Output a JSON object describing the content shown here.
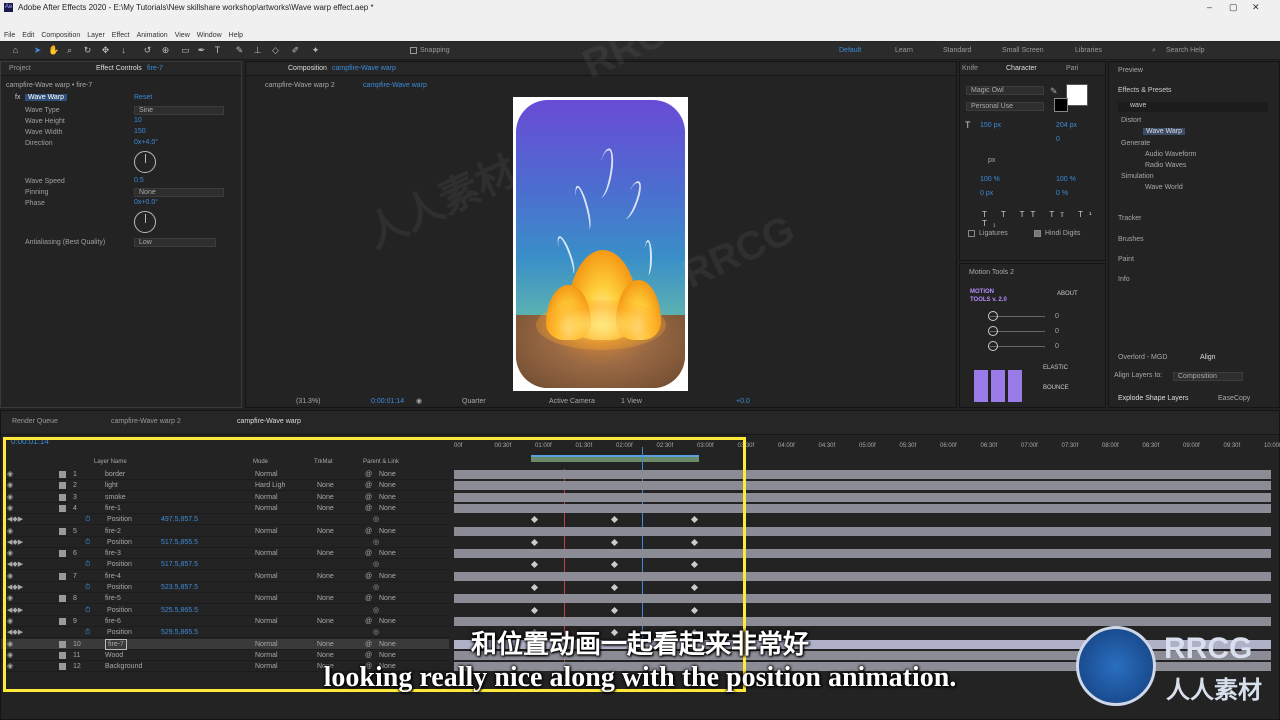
{
  "titlebar": {
    "title": "Adobe After Effects 2020 - E:\\My Tutorials\\New skillshare workshop\\artworks\\Wave warp effect.aep *"
  },
  "menu": [
    "File",
    "Edit",
    "Composition",
    "Layer",
    "Effect",
    "Animation",
    "View",
    "Window",
    "Help"
  ],
  "toolbar": {
    "snapping": "Snapping",
    "workspaces": [
      "Default",
      "Learn",
      "Standard",
      "Small Screen",
      "Libraries"
    ],
    "search_placeholder": "Search Help"
  },
  "project": {
    "tab_project": "Project",
    "tab_effect": "Effect Controls",
    "tab_effect_layer": "fire-7",
    "path": "campfire-Wave warp • fire-7"
  },
  "effect": {
    "name": "Wave Warp",
    "reset": "Reset",
    "rows": [
      {
        "label": "Wave Type",
        "value": "Sine"
      },
      {
        "label": "Wave Height",
        "value": "10"
      },
      {
        "label": "Wave Width",
        "value": "150"
      },
      {
        "label": "Direction",
        "value": "0x+4.0°"
      },
      {
        "label": "Wave Speed",
        "value": "0.5"
      },
      {
        "label": "Pinning",
        "value": "None"
      },
      {
        "label": "Phase",
        "value": "0x+0.0°"
      },
      {
        "label": "Antialiasing (Best Quality)",
        "value": "Low"
      }
    ]
  },
  "composition": {
    "tab": "Composition",
    "tab_comp": "campfire-Wave warp",
    "crumbs": [
      "campfire-Wave warp 2",
      "campfire-Wave warp"
    ],
    "zoom": "(31.3%)",
    "time": "0:00:01:14",
    "resolution": "Quarter",
    "camera": "Active Camera",
    "view": "1 View",
    "exposure": "+0.0"
  },
  "character": {
    "tabs": [
      "Knife",
      "Character",
      "Pari"
    ],
    "font": "Magic Owl",
    "style": "Personal Use",
    "size": "150 px",
    "leading": "204 px",
    "tracking": "0",
    "units": "px",
    "vscale": "100 %",
    "hscale": "100 %",
    "baseline": "0 px",
    "tsume": "0 %",
    "ligatures": "Ligatures",
    "hindi": "Hindi Digits"
  },
  "motion_tools": {
    "title": "Motion Tools 2",
    "logo": "MOTION TOOLS v. 2.0",
    "about": "ABOUT",
    "values": [
      "0",
      "0",
      "0"
    ],
    "elastic": "ELASTIC",
    "bounce": "BOUNCE"
  },
  "overlord": {
    "tabs": [
      "Overlord - MGD",
      "Align"
    ],
    "align_to_label": "Align Layers to:",
    "align_to": "Composition",
    "explode": "Explode Shape Layers",
    "ease": "EaseCopy"
  },
  "right": {
    "preview": "Preview",
    "effects_presets": "Effects & Presets",
    "search": "wave",
    "tree": [
      {
        "label": "Distort",
        "items": [
          "Wave Warp"
        ]
      },
      {
        "label": "Generate",
        "items": [
          "Audio Waveform",
          "Radio Waves"
        ]
      },
      {
        "label": "Simulation",
        "items": [
          "Wave World"
        ]
      }
    ],
    "panels": [
      "Tracker",
      "Brushes",
      "Paint",
      "Info"
    ]
  },
  "timeline": {
    "tabs": [
      "Render Queue",
      "campfire-Wave warp 2",
      "campfire-Wave warp"
    ],
    "time_code": "0:00:01:14",
    "columns": {
      "name": "Layer Name",
      "mode": "Mode",
      "trkmat": "TrkMat",
      "parent": "Parent & Link"
    },
    "ruler": [
      "00f",
      "00:30f",
      "01:00f",
      "01:30f",
      "02:00f",
      "02:30f",
      "03:00f",
      "03:30f",
      "04:00f",
      "04:30f",
      "05:00f",
      "05:30f",
      "06:00f",
      "06:30f",
      "07:00f",
      "07:30f",
      "08:00f",
      "08:30f",
      "09:00f",
      "09:30f",
      "10:00f"
    ],
    "layers": [
      {
        "num": "1",
        "name": "border",
        "mode": "Normal",
        "trk": "",
        "parent": "None"
      },
      {
        "num": "2",
        "name": "light",
        "mode": "Hard Ligh",
        "trk": "None",
        "parent": "None"
      },
      {
        "num": "3",
        "name": "smoke",
        "mode": "Normal",
        "trk": "None",
        "parent": "None"
      },
      {
        "num": "4",
        "name": "fire-1",
        "mode": "Normal",
        "trk": "None",
        "parent": "None",
        "pos": "497.5,857.5"
      },
      {
        "num": "5",
        "name": "fire-2",
        "mode": "Normal",
        "trk": "None",
        "parent": "None",
        "pos": "517.5,855.5"
      },
      {
        "num": "6",
        "name": "fire-3",
        "mode": "Normal",
        "trk": "None",
        "parent": "None",
        "pos": "517.5,857.5"
      },
      {
        "num": "7",
        "name": "fire-4",
        "mode": "Normal",
        "trk": "None",
        "parent": "None",
        "pos": "523.5,857.5"
      },
      {
        "num": "8",
        "name": "fire-5",
        "mode": "Normal",
        "trk": "None",
        "parent": "None",
        "pos": "525.5,865.5"
      },
      {
        "num": "9",
        "name": "fire-6",
        "mode": "Normal",
        "trk": "None",
        "parent": "None",
        "pos": "529.5,865.5"
      },
      {
        "num": "10",
        "name": "fire-7",
        "mode": "Normal",
        "trk": "None",
        "parent": "None"
      },
      {
        "num": "11",
        "name": "Wood",
        "mode": "Normal",
        "trk": "None",
        "parent": "None"
      },
      {
        "num": "12",
        "name": "Background",
        "mode": "Normal",
        "trk": "None",
        "parent": "None"
      }
    ],
    "position_label": "Position"
  },
  "subtitles": {
    "zh": "和位置动画一起看起来非常好",
    "en": "looking really nice along with the position animation."
  },
  "watermark": {
    "logo_top": "RRCG",
    "logo_bottom": "人人素材"
  },
  "colors": {
    "accent": "#3d8bd8",
    "highlight": "#ffe93a"
  }
}
